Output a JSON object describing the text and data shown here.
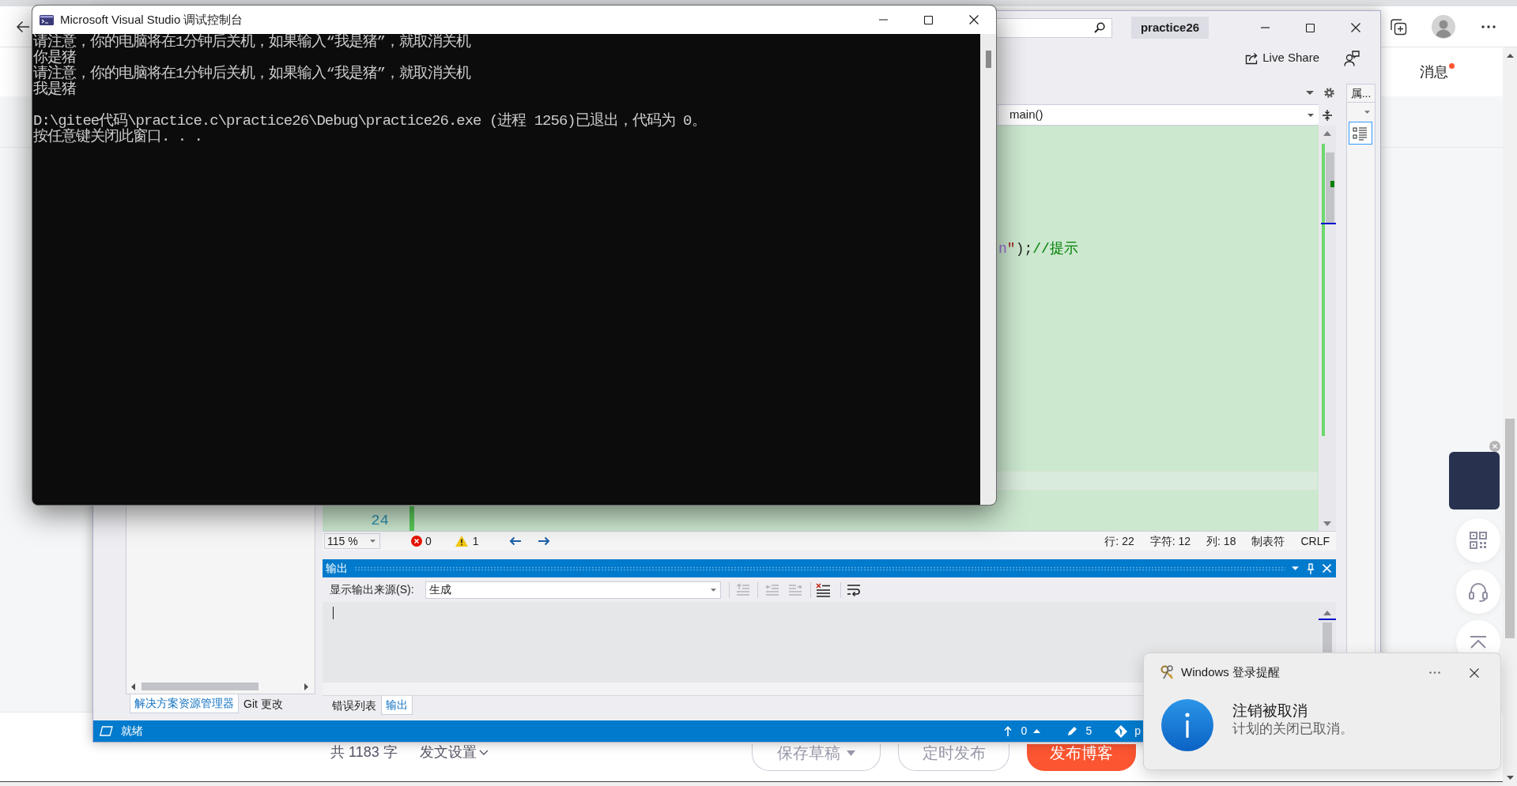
{
  "browser": {
    "messages": {
      "label": "消息",
      "unread": true
    },
    "footer": {
      "word_count": "共 1183 字",
      "settings": "发文设置",
      "buttons": [
        {
          "label": "保存草稿",
          "kind": "menu"
        },
        {
          "label": "定时发布",
          "kind": "outline"
        },
        {
          "label": "发布博客",
          "kind": "primary"
        }
      ]
    }
  },
  "visual_studio": {
    "project": "practice26",
    "live_share": "Live Share",
    "properties_tab": "属...",
    "member": "main()",
    "editor": {
      "code_line": [
        {
          "text": "n",
          "kind": "format"
        },
        {
          "text": "\"",
          "kind": "string"
        },
        {
          "text": ");",
          "kind": "punctuation"
        },
        {
          "text": "//提示",
          "kind": "comment"
        }
      ],
      "line_number": "24"
    },
    "editor_status": {
      "zoom": "115 %",
      "errors": "0",
      "warnings": "1",
      "position": [
        "行: 22",
        "字符: 12",
        "列: 18",
        "制表符",
        "CRLF"
      ]
    },
    "output": {
      "title": "输出",
      "source_label": "显示输出来源(S):",
      "source": "生成",
      "tools": [
        {
          "kind": "find",
          "disabled": true
        },
        {
          "kind": "previous",
          "disabled": true
        },
        {
          "kind": "next",
          "disabled": true
        },
        {
          "kind": "clear",
          "disabled": false
        },
        {
          "kind": "wrap",
          "disabled": false
        }
      ]
    },
    "side_tabs": [
      {
        "label": "解决方案资源管理器",
        "selected": true
      },
      {
        "label": "Git 更改",
        "selected": false
      }
    ],
    "bottom_tabs": [
      {
        "label": "错误列表",
        "selected": false
      },
      {
        "label": "输出",
        "selected": true
      }
    ],
    "status_bar": {
      "text": "就绪",
      "outgoing": "0",
      "changes": "5",
      "branch": "p"
    }
  },
  "console": {
    "title": "Microsoft Visual Studio 调试控制台",
    "blocks": [
      [
        "请注意，你的电脑将在1分钟后关机，如果输入“我是猪”，就取消关机",
        "你是猪",
        "请注意，你的电脑将在1分钟后关机，如果输入“我是猪”，就取消关机",
        "我是猪"
      ],
      [
        "D:\\gitee代码\\practice.c\\practice26\\Debug\\practice26.exe (进程 1256)已退出，代码为 0。",
        "按任意键关闭此窗口. . ."
      ]
    ]
  },
  "notification": {
    "app": "Windows 登录提醒",
    "title": "注销被取消",
    "message": "计划的关闭已取消。"
  }
}
